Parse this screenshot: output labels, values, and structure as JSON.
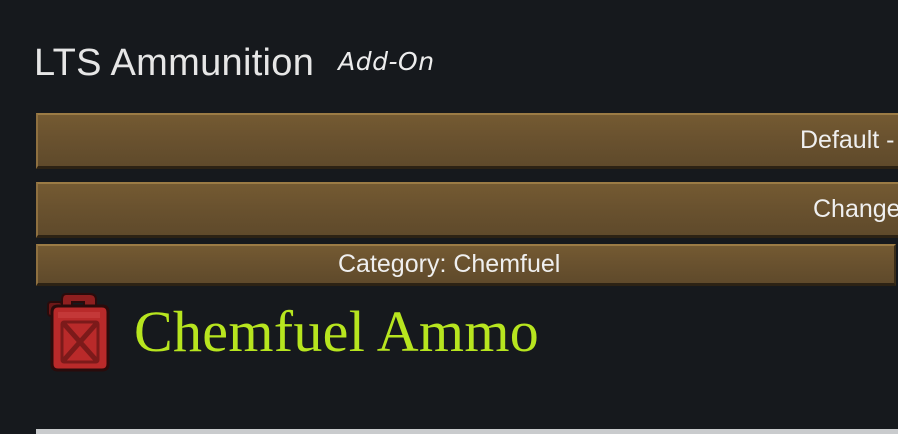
{
  "header": {
    "title": "LTS Ammunition",
    "subtitle": "Add-On"
  },
  "buttons": {
    "default_label": "Default -",
    "change_label": "Change",
    "category_label": "Category: Chemfuel"
  },
  "item": {
    "name": "Chemfuel Ammo",
    "icon": "jerrycan-icon"
  },
  "colors": {
    "background": "#16191d",
    "button_brown": "#6a522f",
    "item_title": "#b7e51f",
    "jerrycan_red": "#b92a2a"
  }
}
